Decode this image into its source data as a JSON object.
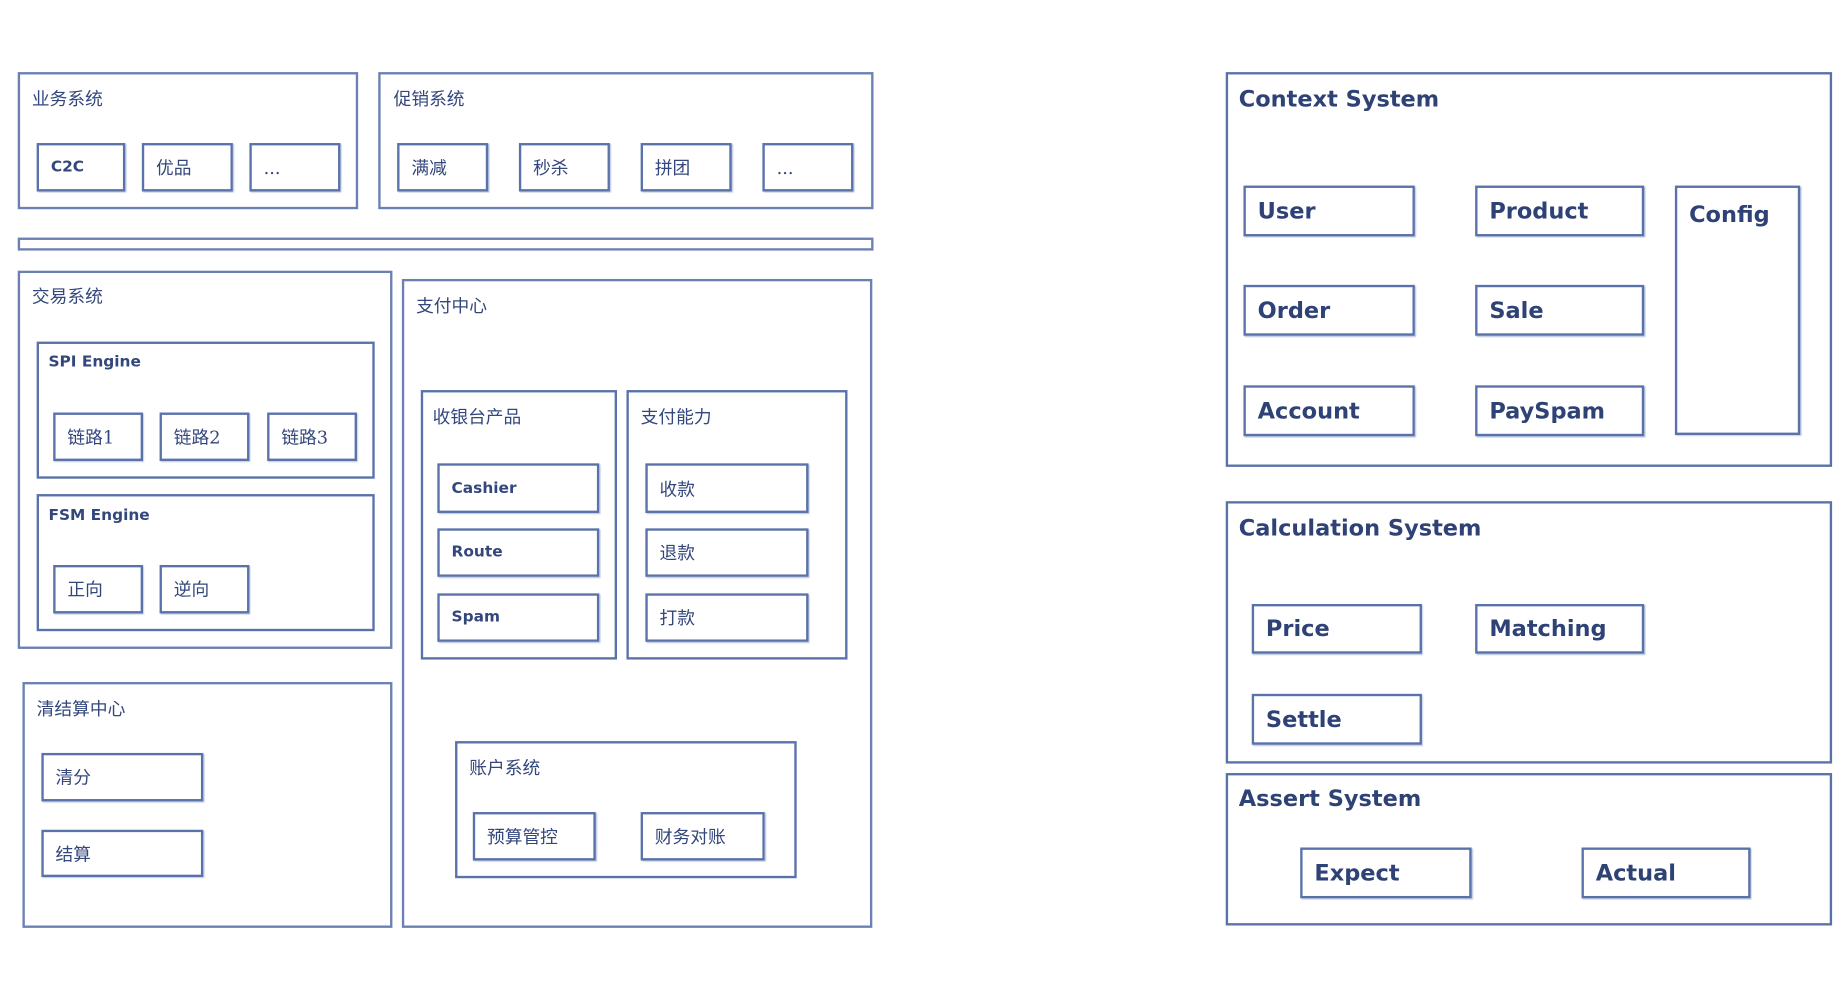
{
  "left": {
    "business": {
      "title": "业务系统",
      "items": [
        "C2C",
        "优品",
        "..."
      ]
    },
    "promotion": {
      "title": "促销系统",
      "items": [
        "满减",
        "秒杀",
        "拼团",
        "..."
      ]
    },
    "trade": {
      "title": "交易系统",
      "spi": {
        "title": "SPI Engine",
        "items": [
          "链路1",
          "链路2",
          "链路3"
        ]
      },
      "fsm": {
        "title": "FSM Engine",
        "items": [
          "正向",
          "逆向"
        ]
      }
    },
    "payment": {
      "title": "支付中心",
      "cashier": {
        "title": "收银台产品",
        "items": [
          "Cashier",
          "Route",
          "Spam"
        ]
      },
      "ability": {
        "title": "支付能力",
        "items": [
          "收款",
          "退款",
          "打款"
        ]
      },
      "account": {
        "title": "账户系统",
        "items": [
          "预算管控",
          "财务对账"
        ]
      }
    },
    "clearing": {
      "title": "清结算中心",
      "items": [
        "清分",
        "结算"
      ]
    }
  },
  "right": {
    "context": {
      "title": "Context System",
      "items": [
        "User",
        "Product",
        "Config",
        "Order",
        "Sale",
        "Account",
        "PaySpam"
      ]
    },
    "calculation": {
      "title": "Calculation System",
      "items": [
        "Price",
        "Matching",
        "Settle"
      ]
    },
    "assert": {
      "title": "Assert System",
      "items": [
        "Expect",
        "Actual"
      ]
    }
  },
  "colors": {
    "border": "#5a72aa",
    "text": "#33477c"
  }
}
